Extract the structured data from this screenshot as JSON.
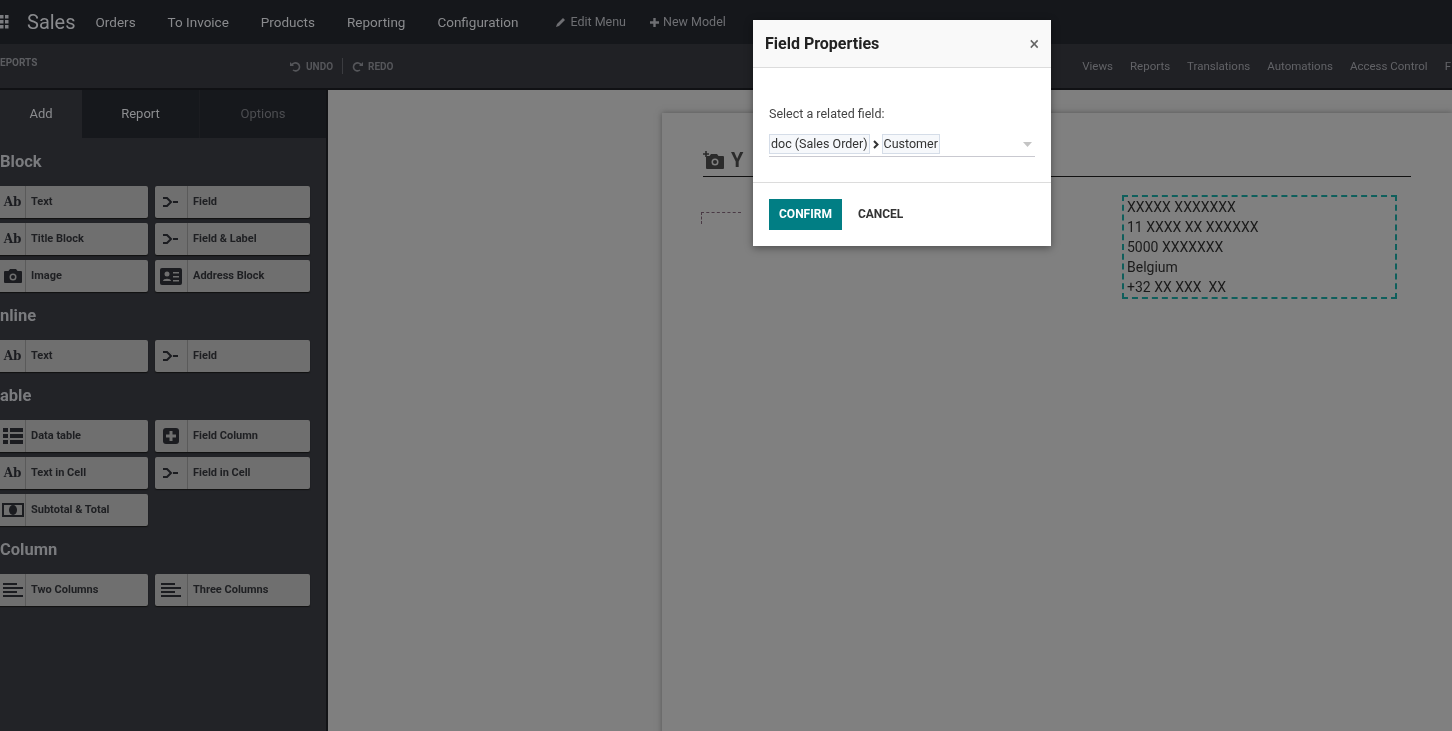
{
  "navbar": {
    "app": "Sales",
    "menu": [
      "Orders",
      "To Invoice",
      "Products",
      "Reporting",
      "Configuration"
    ],
    "edit_menu": "Edit Menu",
    "new_model": "New Model"
  },
  "toolbar": {
    "title": "EPORTS",
    "undo": "UNDO",
    "redo": "REDO",
    "tabs": [
      "Views",
      "Reports",
      "Translations",
      "Automations",
      "Access Control",
      "F"
    ]
  },
  "sidebar": {
    "tabs": [
      {
        "label": "Add",
        "selected": true
      },
      {
        "label": "Report",
        "selected": false
      },
      {
        "label": "Options",
        "selected": false,
        "disabled": true
      }
    ],
    "sections": [
      {
        "title": "Block",
        "items": [
          {
            "label": "Text",
            "kind": "text",
            "icon_text": "Ab"
          },
          {
            "label": "Field",
            "kind": "field"
          },
          {
            "label": "Title Block",
            "kind": "text",
            "icon_text": "Ab"
          },
          {
            "label": "Field & Label",
            "kind": "field"
          },
          {
            "label": "Image",
            "kind": "image"
          },
          {
            "label": "Address Block",
            "kind": "address"
          }
        ]
      },
      {
        "title": "nline",
        "items": [
          {
            "label": "Text",
            "kind": "text",
            "icon_text": "Ab"
          },
          {
            "label": "Field",
            "kind": "field"
          }
        ]
      },
      {
        "title": "able",
        "items": [
          {
            "label": "Data table",
            "kind": "table"
          },
          {
            "label": "Field Column",
            "kind": "plus"
          },
          {
            "label": "Text in Cell",
            "kind": "text",
            "icon_text": "Ab"
          },
          {
            "label": "Field in Cell",
            "kind": "field"
          },
          {
            "label": "Subtotal & Total",
            "kind": "money"
          }
        ]
      },
      {
        "title": "Column",
        "items": [
          {
            "label": "Two Columns",
            "kind": "columns"
          },
          {
            "label": "Three Columns",
            "kind": "columns"
          }
        ]
      }
    ]
  },
  "report": {
    "header_text": "Y",
    "address": [
      "XXXXX XXXXXXX",
      "11 XXXX XX XXXXXX",
      "5000 XXXXXXX",
      "Belgium",
      "+32 XX XXX  XX"
    ]
  },
  "dialog": {
    "title": "Field Properties",
    "close": "×",
    "label": "Select a related field:",
    "path": [
      "doc (Sales Order)",
      "Customer"
    ],
    "confirm": "CONFIRM",
    "cancel": "CANCEL"
  }
}
